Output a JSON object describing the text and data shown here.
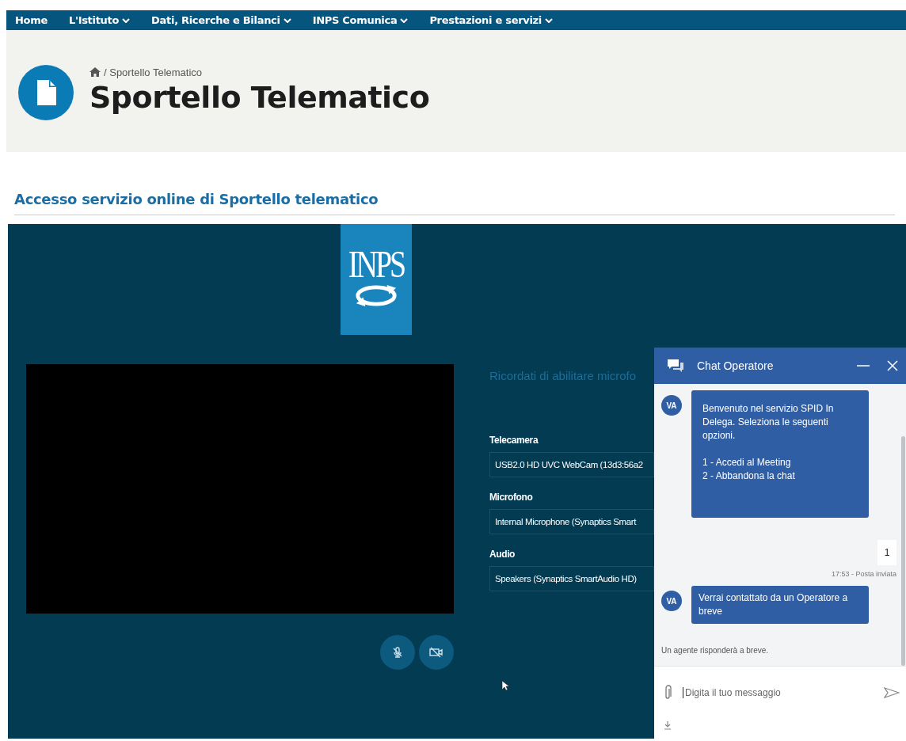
{
  "nav": {
    "items": [
      {
        "label": "Home",
        "dropdown": false
      },
      {
        "label": "L'Istituto",
        "dropdown": true
      },
      {
        "label": "Dati, Ricerche e Bilanci",
        "dropdown": true
      },
      {
        "label": "INPS Comunica",
        "dropdown": true
      },
      {
        "label": "Prestazioni e servizi",
        "dropdown": true
      }
    ]
  },
  "header": {
    "breadcrumb": "/ Sportello Telematico",
    "title": "Sportello Telematico"
  },
  "section_title": "Accesso servizio online di Sportello telematico",
  "session": {
    "logo_text": "INPS",
    "notice": "Ricordati di abilitare microfo",
    "devices": [
      {
        "label": "Telecamera",
        "value": "USB2.0 HD UVC WebCam (13d3:56a2"
      },
      {
        "label": "Microfono",
        "value": "Internal Microphone (Synaptics Smart"
      },
      {
        "label": "Audio",
        "value": "Speakers (Synaptics SmartAudio HD)"
      }
    ],
    "controls": [
      {
        "kind": "mic-off"
      },
      {
        "kind": "camera-off"
      }
    ]
  },
  "chat": {
    "title": "Chat Operatore",
    "messages": [
      {
        "kind": "agent",
        "avatar": "VA",
        "text": "Benvenuto nel servizio SPID In Delega. Seleziona le seguenti opzioni.\n\n1 - Accedi al Meeting\n2 - Abbandona la chat"
      },
      {
        "kind": "user",
        "text": "1",
        "meta": "17:53 - Posta inviata"
      },
      {
        "kind": "agent",
        "avatar": "VA",
        "text": "Verrai contattato da un Operatore a breve"
      }
    ],
    "status": "Un agente risponderà a breve.",
    "input": {
      "placeholder": "Digita il tuo messaggio"
    }
  }
}
